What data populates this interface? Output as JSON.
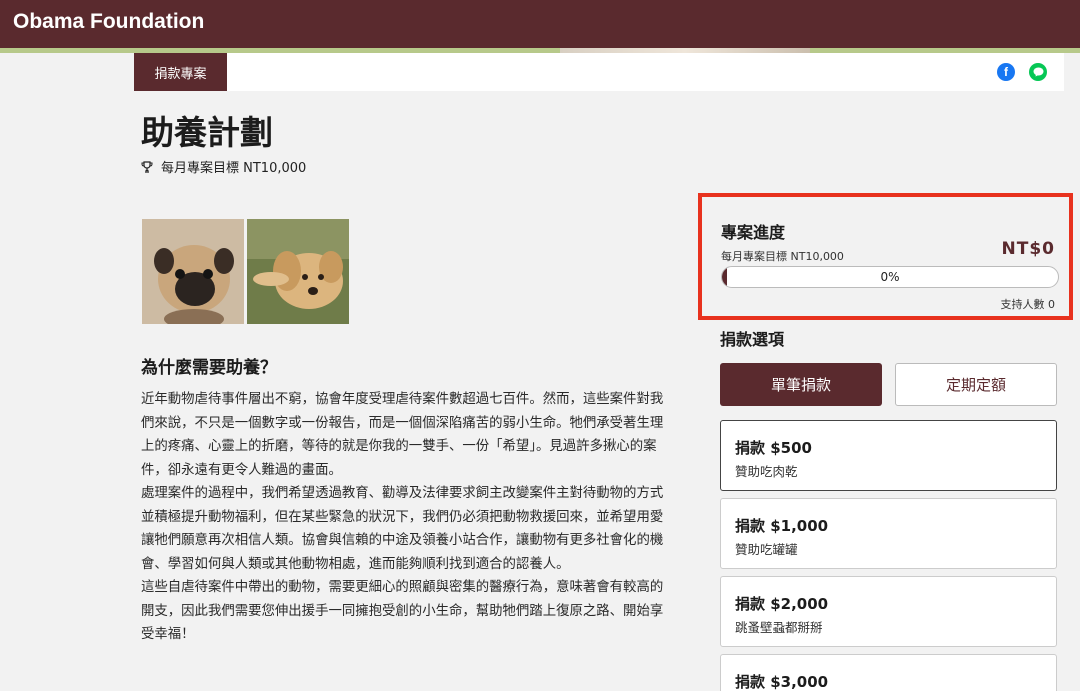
{
  "header": {
    "brand": "Obama Foundation"
  },
  "breadcrumb": {
    "label": "捐款專案"
  },
  "project": {
    "title": "助養計劃",
    "monthly_goal": "每月專案目標 NT10,000"
  },
  "article": {
    "heading": "為什麼需要助養？",
    "paragraphs": [
      "近年動物虐待事件層出不窮，協會年度受理虐待案件數超過七百件。然而，這些案件對我們來說，不只是一個數字或一份報告，而是一個個深陷痛苦的弱小生命。牠們承受著生理上的疼痛、心靈上的折磨，等待的就是你我的一雙手、一份「希望」。見過許多揪心的案件，卻永遠有更令人難過的畫面。",
      "處理案件的過程中，我們希望透過教育、勸導及法律要求飼主改變案件主對待動物的方式並積極提升動物福利，但在某些緊急的狀況下，我們仍必須把動物救援回來，並希望用愛讓牠們願意再次相信人類。協會與信賴的中途及領養小站合作，讓動物有更多社會化的機會、學習如何與人類或其他動物相處，進而能夠順利找到適合的認養人。",
      "這些自虐待案件中帶出的動物，需要更細心的照顧與密集的醫療行為，意味著會有較高的開支，因此我們需要您伸出援手一同擁抱受創的小生命，幫助牠們踏上復原之路、開始享受幸福！"
    ]
  },
  "progress": {
    "title": "專案進度",
    "goal": "每月專案目標 NT10,000",
    "amount": "NT$0",
    "percent_label": "0%",
    "percent_value": 0,
    "backers": "支持人數 0"
  },
  "options": {
    "title": "捐款選項",
    "single_label": "單筆捐款",
    "recurring_label": "定期定額",
    "items": [
      {
        "amount": "捐款 $500",
        "desc": "贊助吃肉乾"
      },
      {
        "amount": "捐款 $1,000",
        "desc": "贊助吃罐罐"
      },
      {
        "amount": "捐款 $2,000",
        "desc": "跳蚤壁蝨都掰掰"
      },
      {
        "amount": "捐款 $3,000",
        "desc": ""
      }
    ]
  },
  "colors": {
    "brand": "#5a2a2e",
    "highlight_border": "#e8321e",
    "accent_strip": "#b7c98a"
  },
  "icons": [
    "trophy-icon",
    "facebook-icon",
    "line-icon"
  ]
}
